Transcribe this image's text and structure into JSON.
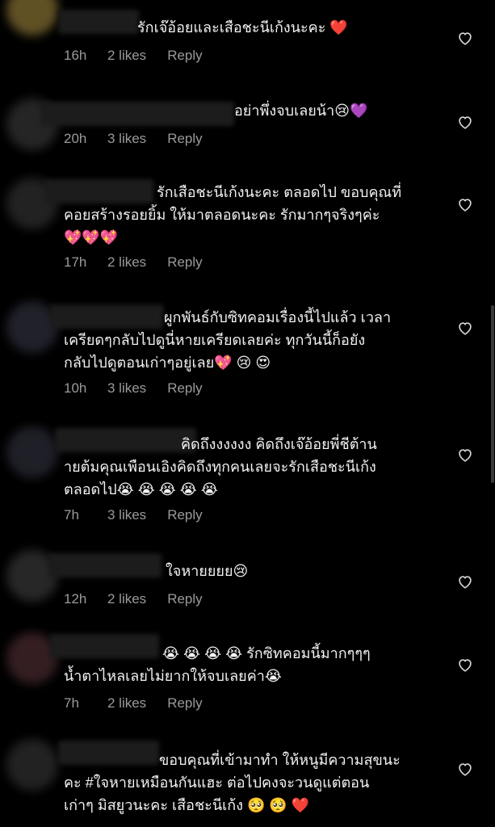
{
  "comments": [
    {
      "text": "รักเจ๊อ้อยและเสือชะนีเก้งนะคะ ❤️",
      "time": "16h",
      "likes": "2 likes",
      "reply": "Reply"
    },
    {
      "text": "อย่าพึ่งจบเลยน้า😢💜",
      "time": "20h",
      "likes": "3 likes",
      "reply": "Reply"
    },
    {
      "text": "รักเสือชะนีเก้งนะคะ ตลอดไป ขอบคุณที่\nคอยสร้างรอยยิ้ม ให้มาตลอดนะคะ รักมากๆจริงๆค่ะ\n💖💖💖",
      "time": "17h",
      "likes": "2 likes",
      "reply": "Reply"
    },
    {
      "text": "ผูกพันธ์กับซิทคอมเรื่องนี้ไปแล้ว เวลา\nเครียดๆกลับไปดูนี่หายเครียดเลยค่ะ ทุกวันนี้ก็อยัง\nกลับไปดูตอนเก่าๆอยู่เลย💖 😢 😍",
      "time": "10h",
      "likes": "3 likes",
      "reply": "Reply"
    },
    {
      "text": "คิดถึงงงงงง คิดถึงเจ๊อ้อยพี่ชีต้าน\nายต้มคุณเพือนเอิงคิดถึงทุกคนเลยจะรักเสือชะนีเก้ง\nตลอดไป😭 😭 😭 😭 😭",
      "time": "7h",
      "likes": "3 likes",
      "reply": "Reply"
    },
    {
      "text": "ใจหายยยย😢",
      "time": "12h",
      "likes": "2 likes",
      "reply": "Reply"
    },
    {
      "text": "😭 😭 😭 😭 รักซิทคอมนี้มากๆๆๆ\nน้ำตาไหลเลยไม่ยากให้จบเลยค่า😭",
      "time": "7h",
      "likes": "2 likes",
      "reply": "Reply"
    },
    {
      "text": "ขอบคุณที่เข้ามาทำ ให้หนูมีความสุขนะ\nคะ #ใจหายเหมือนกันแฮะ ต่อไปคงจะวนดูแต่ตอน\nเก่าๆ มิสยูวนะคะ เสือชะนีเก้ง 🥺 🥺 ❤️",
      "time": "",
      "likes": "",
      "reply": ""
    }
  ],
  "colors": {
    "background": "#000000",
    "text": "#f2f2f2",
    "meta": "#9a9a9a",
    "heart_stroke": "#d8d8d8"
  },
  "icons": {
    "like": "heart-outline-icon"
  }
}
